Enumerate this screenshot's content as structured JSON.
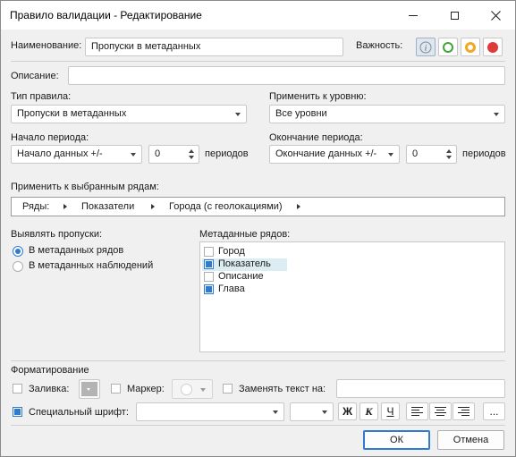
{
  "window": {
    "title": "Правило валидации - Редактирование"
  },
  "titlebar": {
    "minimize_icon": "minimize-icon",
    "maximize_icon": "maximize-icon",
    "close_icon": "close-icon"
  },
  "name": {
    "label": "Наименование:",
    "value": "Пропуски в метаданных"
  },
  "importance": {
    "label": "Важность:",
    "options": [
      {
        "name": "info-icon",
        "color": "#7a8aa0",
        "selected": true
      },
      {
        "name": "green-circle-icon",
        "color": "#3fa535",
        "selected": false
      },
      {
        "name": "orange-circle-icon",
        "color": "#f5a623",
        "selected": false
      },
      {
        "name": "red-circle-icon",
        "color": "#e03a3a",
        "selected": false
      }
    ]
  },
  "description": {
    "label": "Описание:",
    "value": ""
  },
  "rule_type": {
    "label": "Тип правила:",
    "value": "Пропуски в метаданных"
  },
  "apply_level": {
    "label": "Применить к уровню:",
    "value": "Все уровни"
  },
  "period_start": {
    "label": "Начало периода:",
    "value": "Начало данных +/-",
    "count": "0",
    "unit": "периодов"
  },
  "period_end": {
    "label": "Окончание периода:",
    "value": "Окончание данных +/-",
    "count": "0",
    "unit": "периодов"
  },
  "apply_rows": {
    "label": "Применить к выбранным рядам:",
    "crumbs": [
      "Ряды:",
      "Показатели",
      "Города (с геолокациями)"
    ]
  },
  "detect": {
    "label": "Выявлять пропуски:",
    "options": [
      {
        "label": "В метаданных рядов",
        "selected": true
      },
      {
        "label": "В метаданных наблюдений",
        "selected": false
      }
    ]
  },
  "metadata": {
    "label": "Метаданные рядов:",
    "items": [
      {
        "label": "Город",
        "checked": false
      },
      {
        "label": "Показатель",
        "checked": true
      },
      {
        "label": "Описание",
        "checked": false
      },
      {
        "label": "Глава",
        "checked": true
      }
    ]
  },
  "formatting": {
    "label": "Форматирование",
    "fill_label": "Заливка:",
    "marker_label": "Маркер:",
    "replace_label": "Заменять текст на:",
    "replace_value": "",
    "special_font_label": "Специальный шрифт:",
    "font_value": "",
    "size_value": "",
    "bold": "Ж",
    "italic": "К",
    "underline": "Ч",
    "more": "...",
    "special_font_checked": true,
    "fill_checked": false,
    "marker_checked": false,
    "replace_checked": false
  },
  "buttons": {
    "ok": "ОК",
    "cancel": "Отмена"
  }
}
